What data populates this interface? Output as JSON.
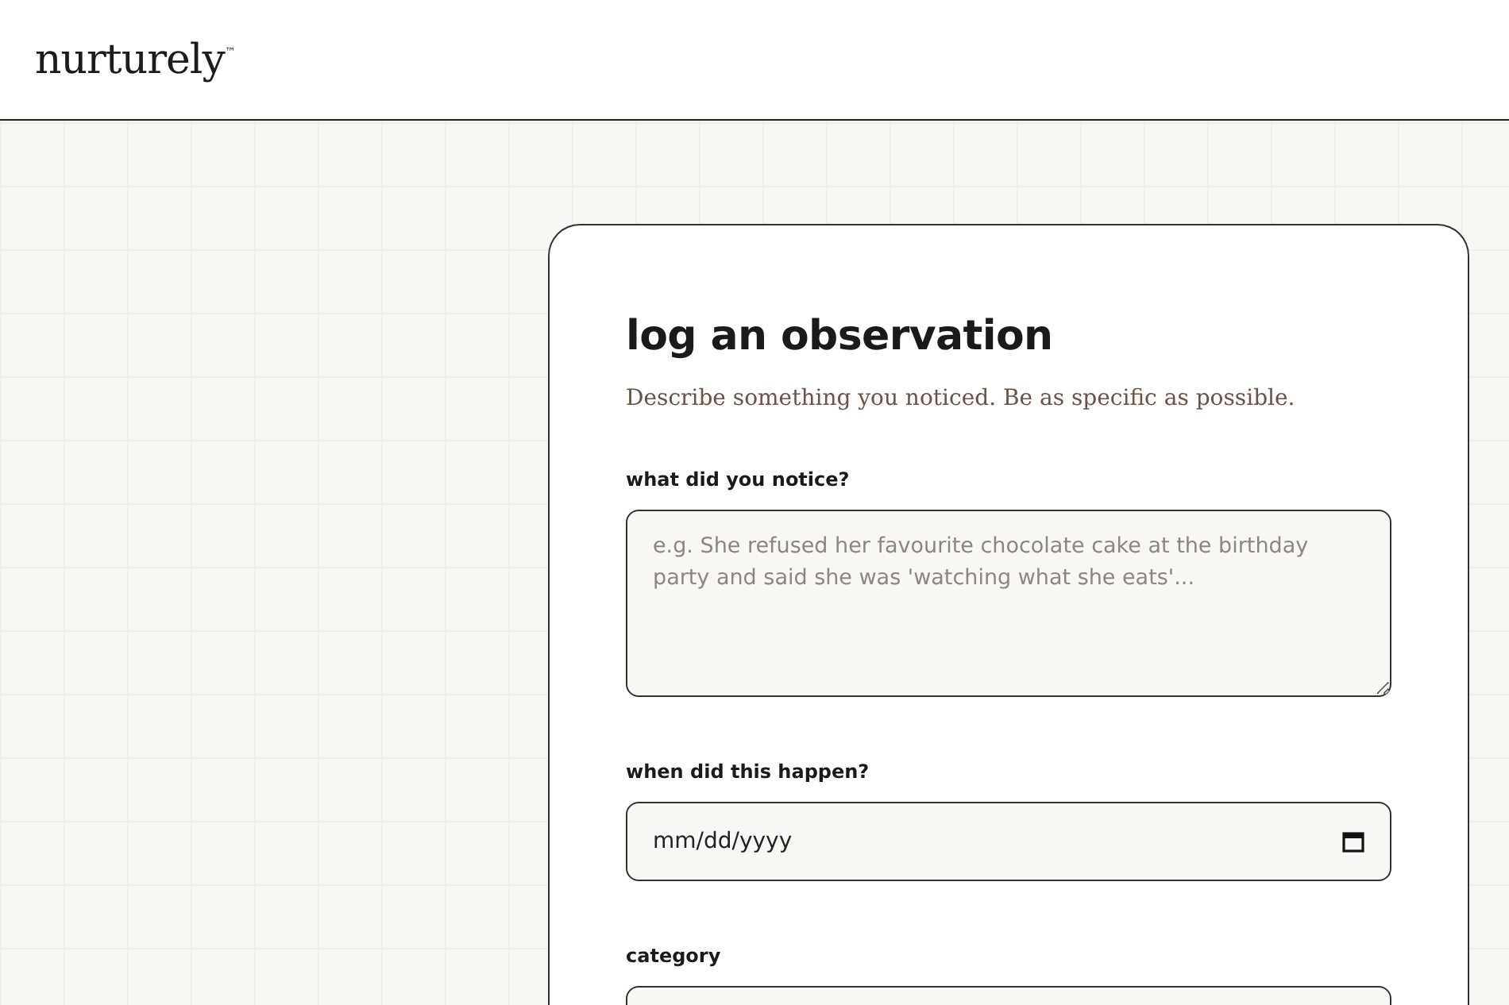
{
  "header": {
    "logo": "nurturely",
    "trademark": "™"
  },
  "form": {
    "title": "log an observation",
    "subtitle": "Describe something you noticed. Be as specific as possible.",
    "fields": [
      {
        "kind": "textarea",
        "label": "what did you notice?",
        "placeholder": "e.g. She refused her favourite chocolate cake at the birthday party and said she was 'watching what she eats'..."
      },
      {
        "kind": "date",
        "label": "when did this happen?",
        "value": "mm/dd/yyyy"
      },
      {
        "kind": "select",
        "label": "category"
      }
    ]
  }
}
